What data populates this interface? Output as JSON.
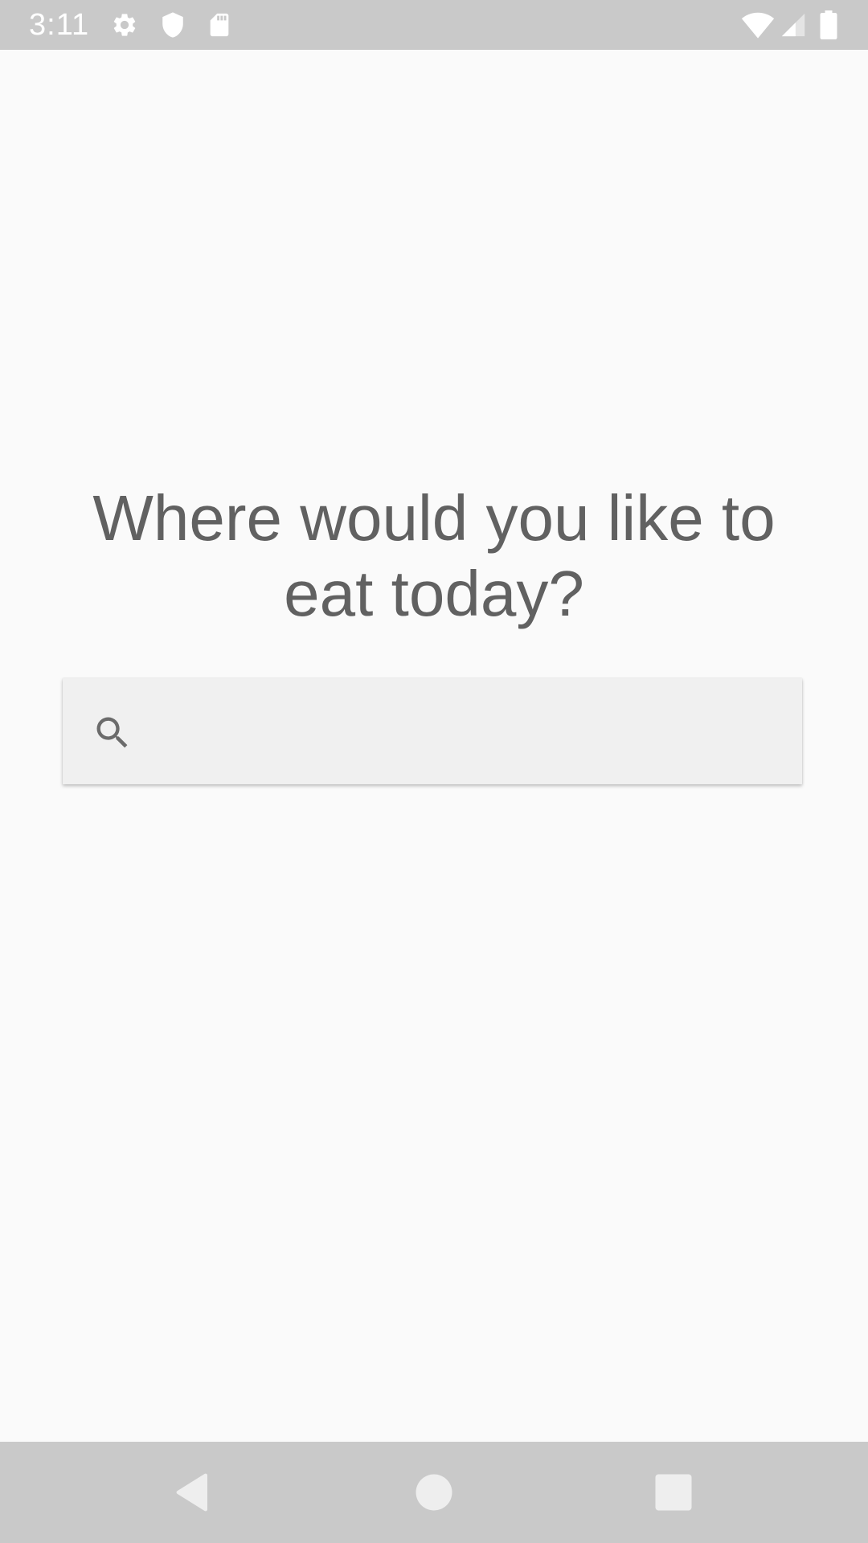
{
  "status_bar": {
    "time": "3:11",
    "left_icons": [
      "settings-gear-icon",
      "shield-icon",
      "sd-card-icon"
    ],
    "right_icons": [
      "wifi-icon",
      "cell-signal-icon",
      "battery-icon"
    ]
  },
  "main": {
    "heading": "Where would you like to eat today?",
    "search": {
      "placeholder": "",
      "value": "",
      "icon": "search-icon"
    }
  },
  "nav_bar": {
    "buttons": [
      "back-icon",
      "home-icon",
      "recents-icon"
    ]
  },
  "colors": {
    "bars": "#c9c9c9",
    "background": "#fafafa",
    "heading_text": "#616161",
    "search_background": "#f0f0f0"
  }
}
